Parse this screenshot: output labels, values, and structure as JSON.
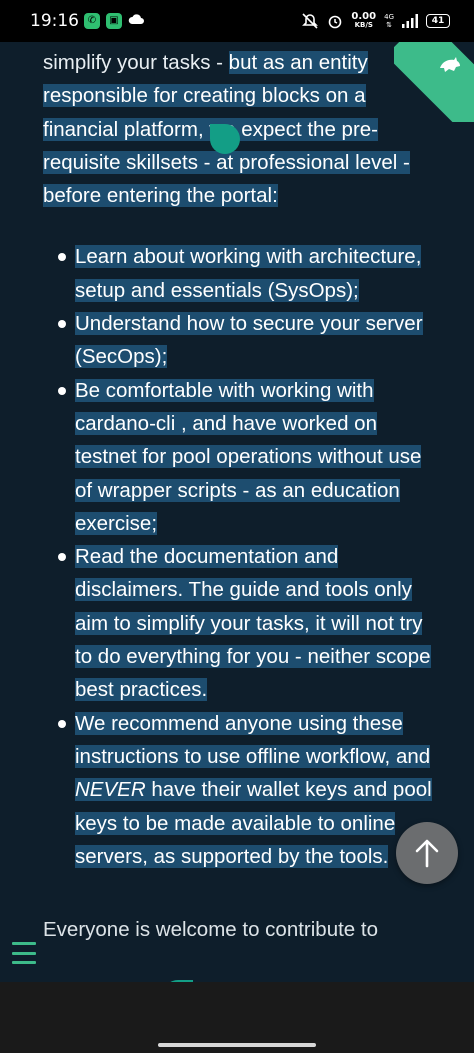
{
  "status_bar": {
    "time": "19:16",
    "net_speed_value": "0.00",
    "net_speed_unit": "KB/S",
    "network_type": "4G",
    "battery": "41"
  },
  "article": {
    "intro_plain": "simplify your tasks - ",
    "intro_highlight": "but as an entity responsible for creating blocks on a financial platform, we expect the pre-requisite skillsets - at professional level - before entering the portal:",
    "bullets": [
      {
        "text": "Learn about working with architecture, setup and essentials (SysOps);"
      },
      {
        "text": "Understand how to secure your server (SecOps);"
      },
      {
        "text": "Be comfortable with working with cardano-cli , and have worked on testnet for pool operations without use of wrapper scripts - as an education exercise;"
      },
      {
        "text": "Read the documentation and disclaimers. The guide and tools only aim to simplify your tasks, it will not try to do everything for you - neither scope best practices."
      },
      {
        "before": "We recommend anyone using these instructions to use offline workflow, and ",
        "emphasis": "NEVER",
        "after": " have their wallet keys and pool keys to be made available to online servers, as supported by the tools."
      }
    ],
    "next_paragraph": "Everyone is welcome to contribute to"
  },
  "colors": {
    "background": "#0e1e2b",
    "selection": "#1d4d6f",
    "accent": "#3dbb8a",
    "handle": "#139e86"
  },
  "icons": {
    "ribbon": "dragon-icon",
    "menu": "hamburger-menu-icon",
    "back_to_top": "arrow-up-icon"
  }
}
